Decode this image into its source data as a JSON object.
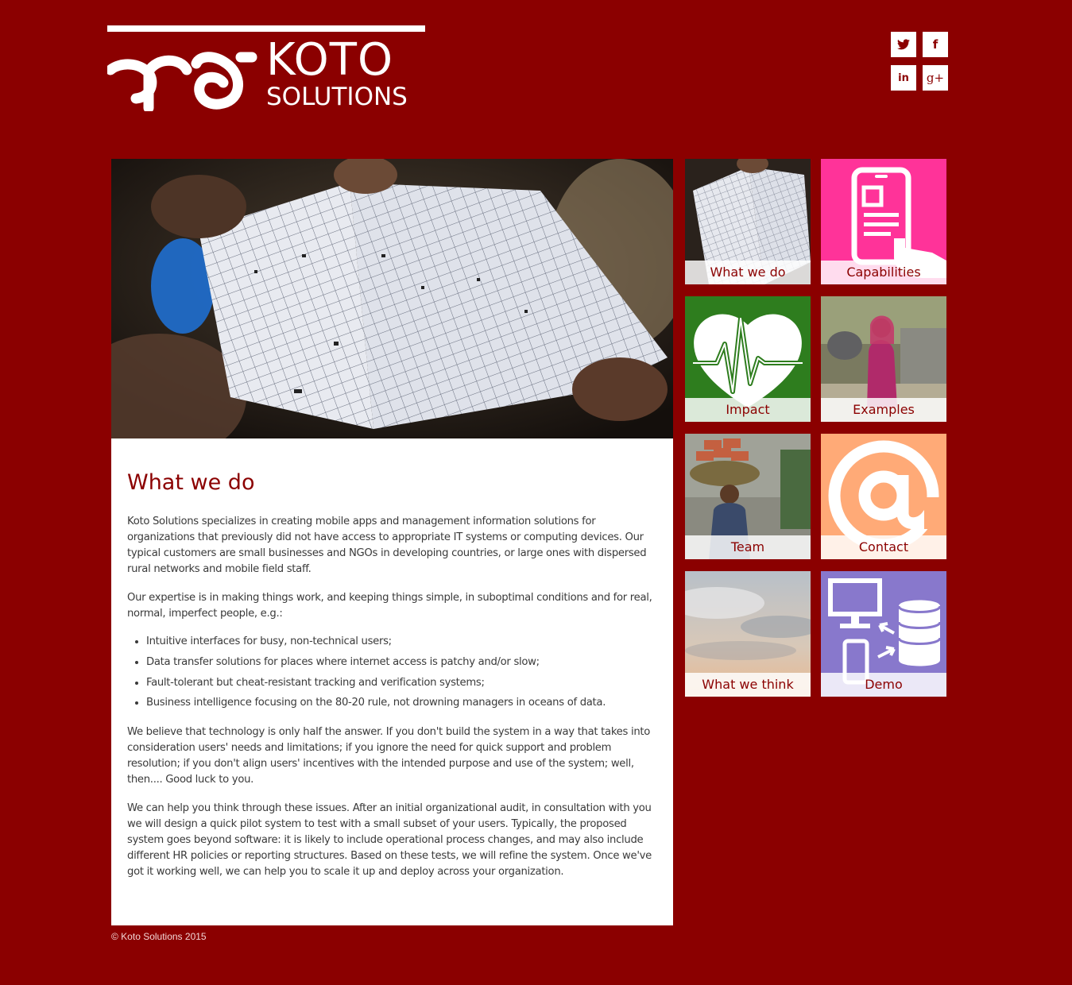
{
  "brand": {
    "name_line1": "KOTO",
    "name_line2": "SOLUTIONS",
    "bg_color": "#8b0000"
  },
  "social": [
    {
      "name": "twitter",
      "icon": "twitter-icon",
      "glyph": "t"
    },
    {
      "name": "facebook",
      "icon": "facebook-icon",
      "glyph": "f"
    },
    {
      "name": "linkedin",
      "icon": "linkedin-icon",
      "glyph": "in"
    },
    {
      "name": "google-plus",
      "icon": "google-plus-icon",
      "glyph": "g+"
    }
  ],
  "hero": {
    "image": "hands holding a paper ledger with handwritten grid entries"
  },
  "main": {
    "title": "What we do",
    "para1": "Koto Solutions specializes in creating mobile apps and management information solutions for organizations that previously did not have access to appropriate IT systems or computing devices. Our typical customers are small businesses and NGOs in developing countries, or large ones with dispersed rural networks and mobile field staff.",
    "para2": "Our expertise is in making things work, and keeping things simple, in suboptimal conditions and for real, normal, imperfect people, e.g.:",
    "bullets": [
      "Intuitive interfaces for busy, non-technical users;",
      "Data transfer solutions for places where internet access is patchy and/or slow;",
      "Fault-tolerant but cheat-resistant tracking and verification systems;",
      "Business intelligence focusing on the 80-20 rule, not drowning managers in oceans of data."
    ],
    "para3": "We believe that technology is only half the answer. If you don't build the system in a way that takes into consideration users' needs and limitations; if you ignore the need for quick support and problem resolution; if you don't align users' incentives with the intended purpose and use of the system; well, then.... Good luck to you.",
    "para4": "We can help you think through these issues. After an initial organizational audit, in consultation with you we will design a quick pilot system to test with a small subset of your users. Typically, the proposed system goes beyond software: it is likely to include operational process changes, and may also include different HR policies or reporting structures. Based on these tests, we will refine the system. Once we've got it working well, we can help you to scale it up and deploy across your organization."
  },
  "tiles": [
    {
      "label": "What we do",
      "icon": "ledger-photo",
      "color": "#d8d8d8"
    },
    {
      "label": "Capabilities",
      "icon": "mobile-touch-icon",
      "color": "#ff3399"
    },
    {
      "label": "Impact",
      "icon": "heart-pulse-icon",
      "color": "#2e7d1e"
    },
    {
      "label": "Examples",
      "icon": "woman-photo",
      "color": "#6b6a55"
    },
    {
      "label": "Team",
      "icon": "bricks-worker-photo",
      "color": "#8a8070"
    },
    {
      "label": "Contact",
      "icon": "at-sign-icon",
      "color": "#ffaa77"
    },
    {
      "label": "What we think",
      "icon": "sky-photo",
      "color": "#c8c0b8"
    },
    {
      "label": "Demo",
      "icon": "computer-database-icon",
      "color": "#8878cc"
    }
  ],
  "footer": {
    "copyright": "© Koto Solutions 2015"
  }
}
